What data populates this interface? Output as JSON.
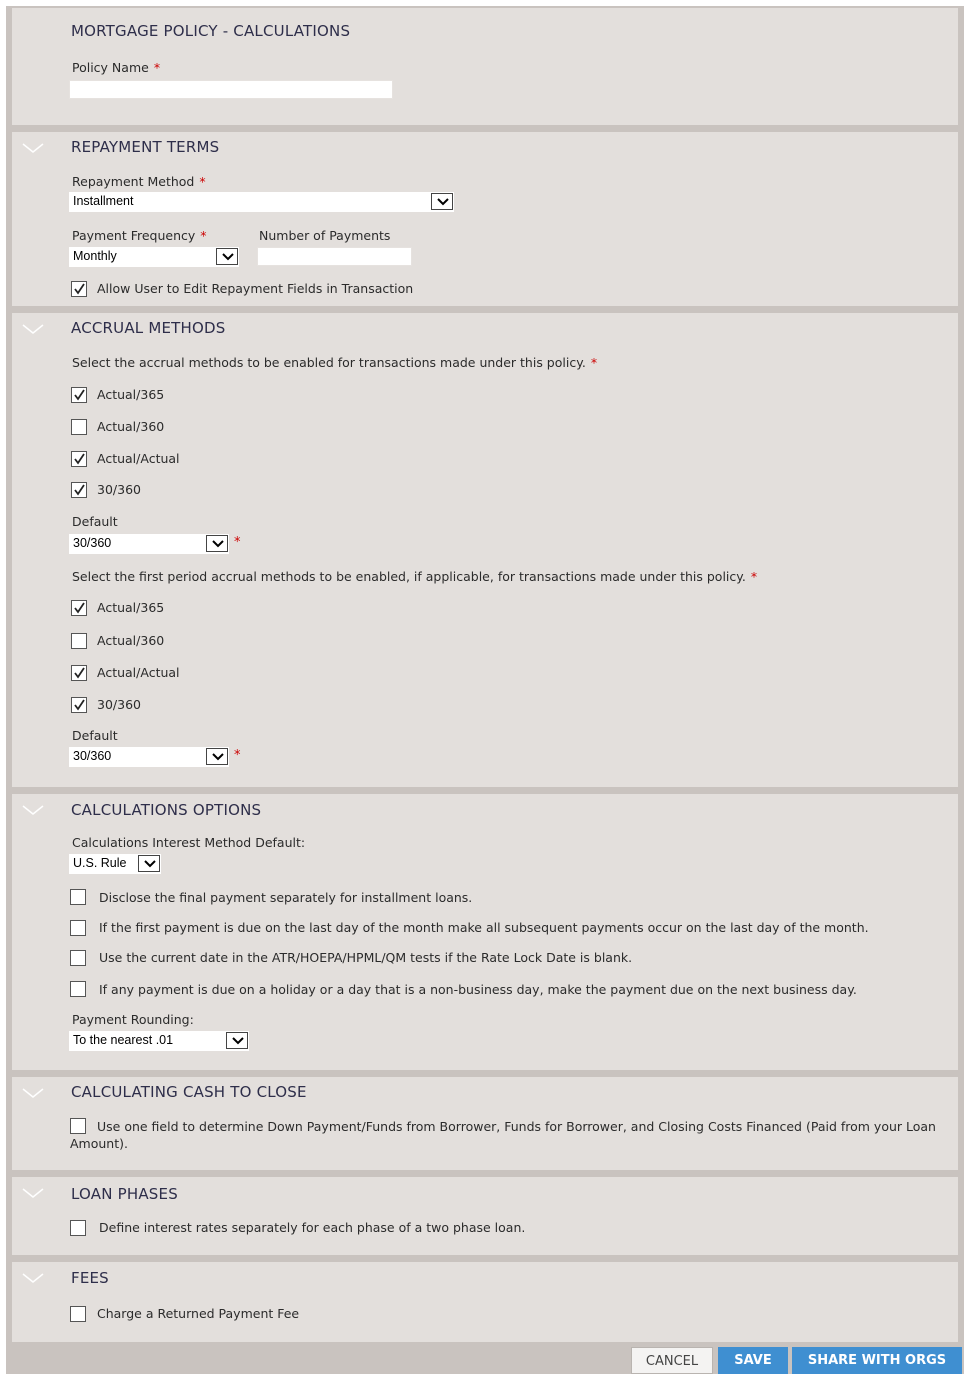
{
  "policy": {
    "title": "MORTGAGE POLICY - CALCULATIONS",
    "name_label": "Policy Name",
    "name_value": "",
    "required_mark": "*"
  },
  "repayment": {
    "title": "REPAYMENT TERMS",
    "method_label": "Repayment Method",
    "method_value": "Installment",
    "frequency_label": "Payment Frequency",
    "frequency_value": "Monthly",
    "num_payments_label": "Number of Payments",
    "num_payments_value": "",
    "allow_edit_label": "Allow User to Edit Repayment Fields in Transaction",
    "allow_edit_checked": true
  },
  "accrual": {
    "title": "ACCRUAL METHODS",
    "intro": "Select the accrual methods to be enabled for transactions made under this policy.",
    "methods": [
      {
        "label": "Actual/365",
        "checked": true
      },
      {
        "label": "Actual/360",
        "checked": false
      },
      {
        "label": "Actual/Actual",
        "checked": true
      },
      {
        "label": "30/360",
        "checked": true
      }
    ],
    "default_label": "Default",
    "default_value": "30/360",
    "first_intro": "Select the first period accrual methods to be enabled, if applicable, for transactions made under this policy.",
    "first_methods": [
      {
        "label": "Actual/365",
        "checked": true
      },
      {
        "label": "Actual/360",
        "checked": false
      },
      {
        "label": "Actual/Actual",
        "checked": true
      },
      {
        "label": "30/360",
        "checked": true
      }
    ],
    "first_default_label": "Default",
    "first_default_value": "30/360"
  },
  "calc_options": {
    "title": "CALCULATIONS OPTIONS",
    "interest_label": "Calculations Interest Method Default:",
    "interest_value": "U.S. Rule",
    "options": [
      {
        "label": "Disclose the final payment separately for installment loans.",
        "checked": false
      },
      {
        "label": "If the first payment is due on the last day of the month make all subsequent payments occur on the last day of the month.",
        "checked": false
      },
      {
        "label": "Use the current date in the ATR/HOEPA/HPML/QM tests if the Rate Lock Date is blank.",
        "checked": false
      },
      {
        "label": "If any payment is due on a holiday or a day that is a non-business day, make the payment due on the next business day.",
        "checked": false
      }
    ],
    "rounding_label": "Payment Rounding:",
    "rounding_value": "To the nearest .01"
  },
  "cash_to_close": {
    "title": "CALCULATING CASH TO CLOSE",
    "option_label": "Use one field to determine Down Payment/Funds from Borrower, Funds for Borrower, and Closing Costs Financed (Paid from your Loan Amount).",
    "option_checked": false
  },
  "loan_phases": {
    "title": "LOAN PHASES",
    "option_label": "Define interest rates separately for each phase of a two phase loan.",
    "option_checked": false
  },
  "fees": {
    "title": "FEES",
    "option_label": "Charge a Returned Payment Fee",
    "option_checked": false
  },
  "actions": {
    "cancel": "CANCEL",
    "save": "SAVE",
    "share": "SHARE WITH ORGS"
  },
  "colors": {
    "accent": "#3f8fd1",
    "required": "#cc0000",
    "section_bg": "#e3dfdc",
    "frame_bg": "#c9c3bf"
  }
}
